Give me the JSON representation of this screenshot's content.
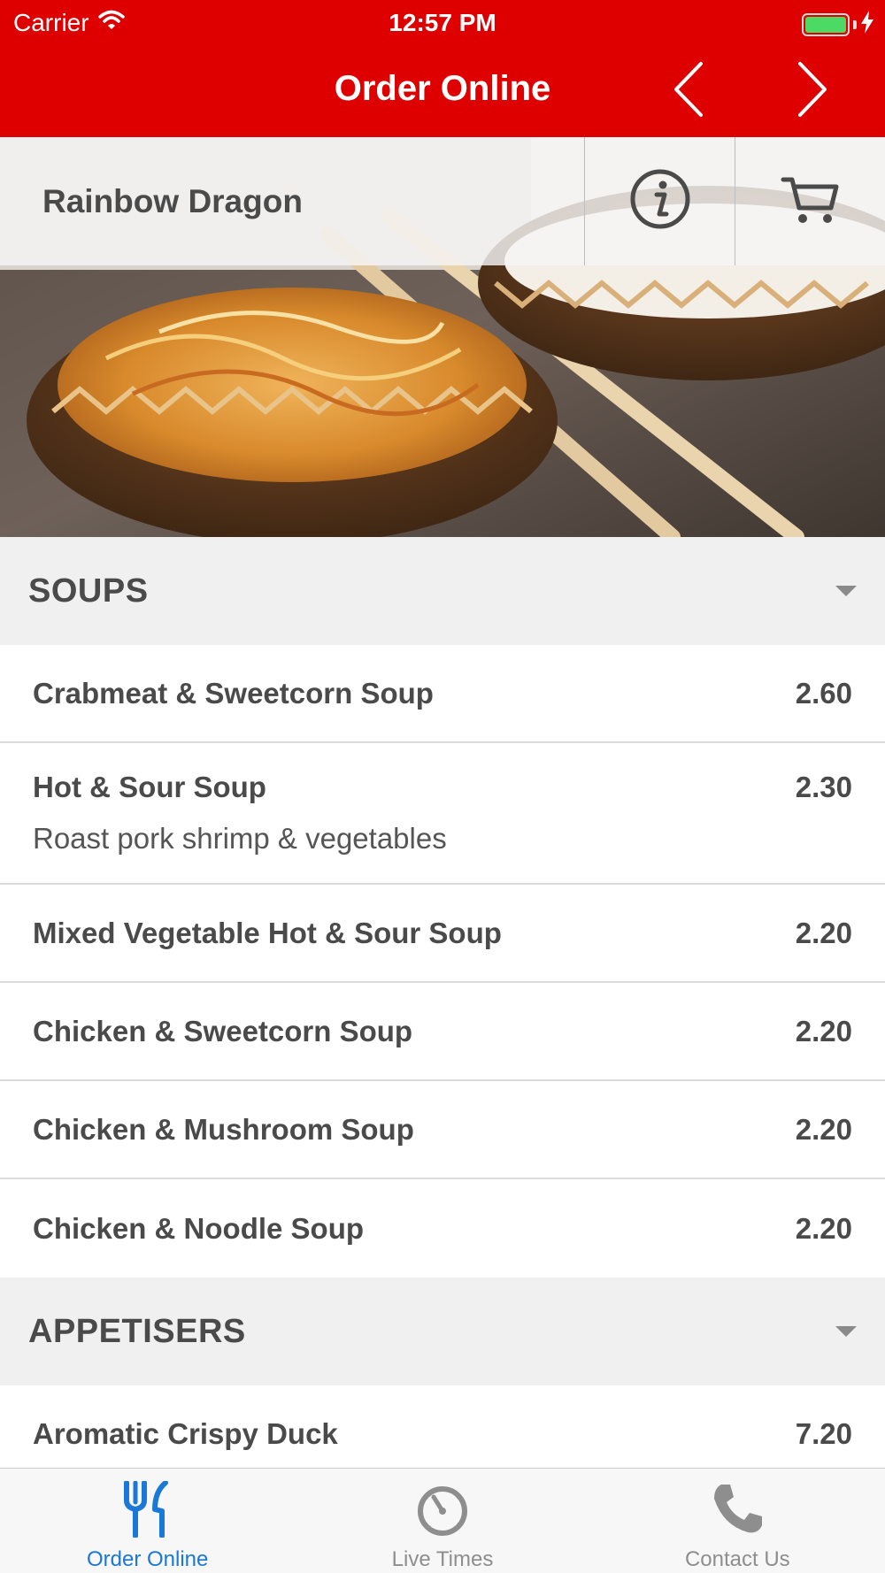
{
  "status_bar": {
    "carrier": "Carrier",
    "time": "12:57 PM"
  },
  "nav": {
    "title": "Order Online",
    "prev_icon": "chevron-left-icon",
    "next_icon": "chevron-right-icon"
  },
  "restaurant": {
    "name": "Rainbow Dragon",
    "info_icon": "info-icon",
    "cart_icon": "cart-icon"
  },
  "categories": [
    {
      "title": "SOUPS",
      "items": [
        {
          "name": "Crabmeat & Sweetcorn Soup",
          "price": "2.60"
        },
        {
          "name": "Hot & Sour Soup",
          "price": "2.30",
          "description": "Roast pork shrimp & vegetables"
        },
        {
          "name": "Mixed Vegetable Hot & Sour Soup",
          "price": "2.20"
        },
        {
          "name": "Chicken & Sweetcorn Soup",
          "price": "2.20"
        },
        {
          "name": "Chicken & Mushroom Soup",
          "price": "2.20"
        },
        {
          "name": "Chicken & Noodle Soup",
          "price": "2.20"
        }
      ]
    },
    {
      "title": "APPETISERS",
      "items": [
        {
          "name": "Aromatic Crispy Duck",
          "price": "7.20"
        }
      ]
    }
  ],
  "tabs": [
    {
      "label": "Order Online",
      "icon": "fork-knife-icon",
      "active": true
    },
    {
      "label": "Live Times",
      "icon": "stopwatch-icon",
      "active": false
    },
    {
      "label": "Contact Us",
      "icon": "phone-icon",
      "active": false
    }
  ],
  "colors": {
    "brand_red": "#de0000",
    "active_tab": "#1a78d6",
    "inactive_tab": "#8e8e8e",
    "battery": "#4cd964"
  }
}
